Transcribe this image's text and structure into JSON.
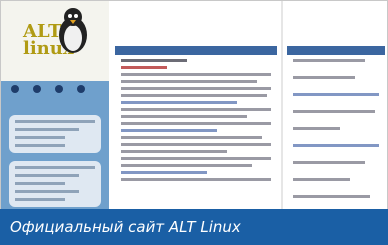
{
  "logo": {
    "line1": "ALT",
    "line2": "linux"
  },
  "caption": "Официальный сайт ALT Linux",
  "colors": {
    "sidebar": "#6fa0cc",
    "panel_header": "#3b66a0",
    "caption_bg": "#1a5fa5"
  },
  "icons": {
    "mascot": "penguin-icon"
  }
}
